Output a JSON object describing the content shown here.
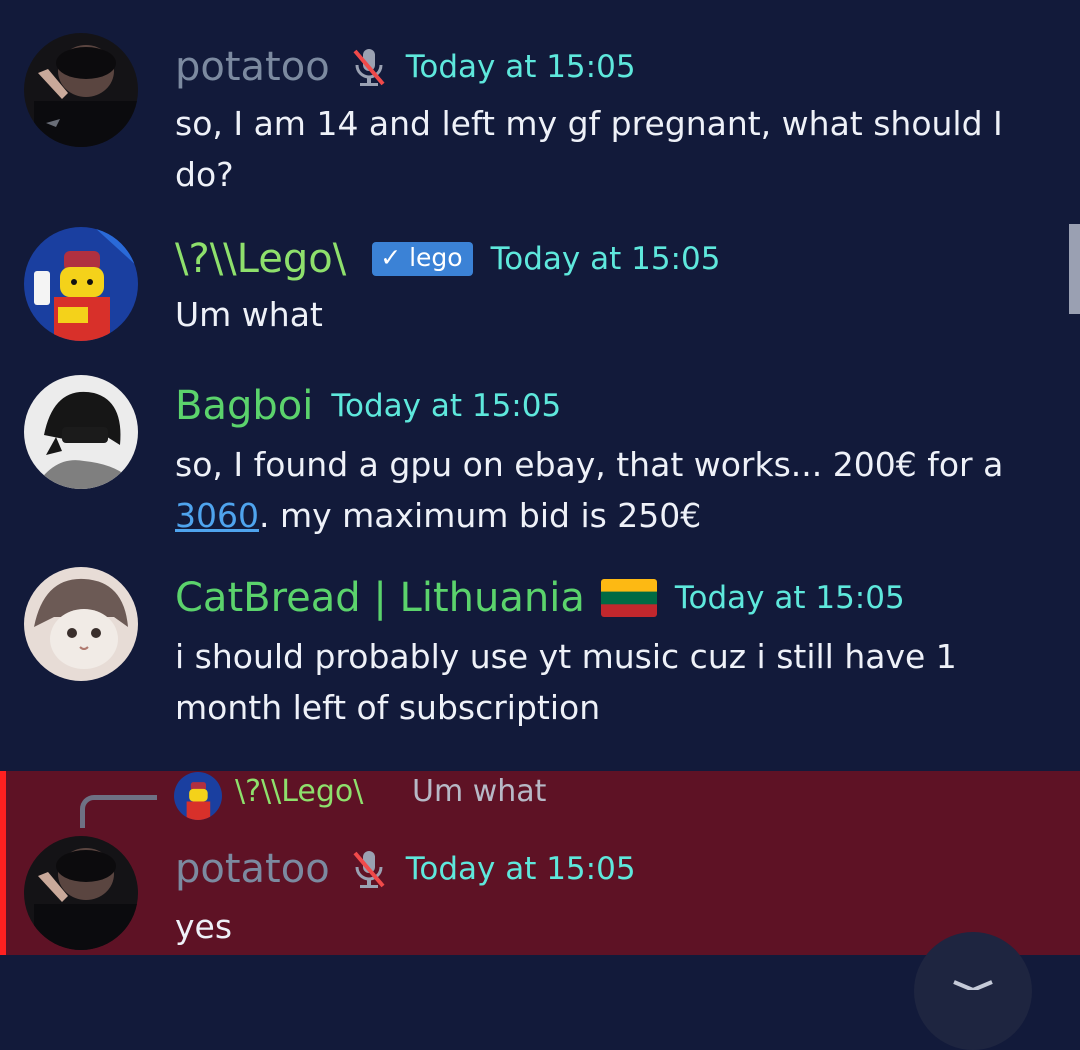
{
  "messages": [
    {
      "author": "potatoo",
      "author_color": "#7c8aa0",
      "muted_mic": true,
      "timestamp": "Today at 15:05",
      "text": "so, I am 14 and left my gf pregnant, what should I do?"
    },
    {
      "author": "\\?\\\\Lego\\",
      "author_color": "#8ee06c",
      "badge": "✓ lego",
      "timestamp": "Today at 15:05",
      "text": "Um what"
    },
    {
      "author": "Bagboi",
      "author_color": "#5bd36c",
      "timestamp": "Today at 15:05",
      "text_before": "so, I found a gpu on ebay, that works... 200€ for a",
      "link": "3060",
      "text_after": ". my maximum bid is 250€"
    },
    {
      "author": "CatBread | Lithuania",
      "author_color": "#5bd36c",
      "flag": "lithuania-flag",
      "timestamp": "Today at 15:05",
      "text": "i should probably use yt music cuz i still have 1 month left of subscription"
    }
  ],
  "reply": {
    "reply_to_author": "\\?\\\\Lego\\",
    "reply_to_text": "Um what",
    "author": "potatoo",
    "muted_mic": true,
    "timestamp": "Today at 15:05",
    "text": "yes"
  },
  "icons": {
    "mic_muted": "mic-muted-icon",
    "jump": "chevron-down-icon"
  },
  "colors": {
    "background": "#121a3a",
    "timestamp": "#5ee8dc",
    "mention_highlight": "#5e1225",
    "mention_bar": "#ff2020",
    "link": "#4fa4ee"
  }
}
